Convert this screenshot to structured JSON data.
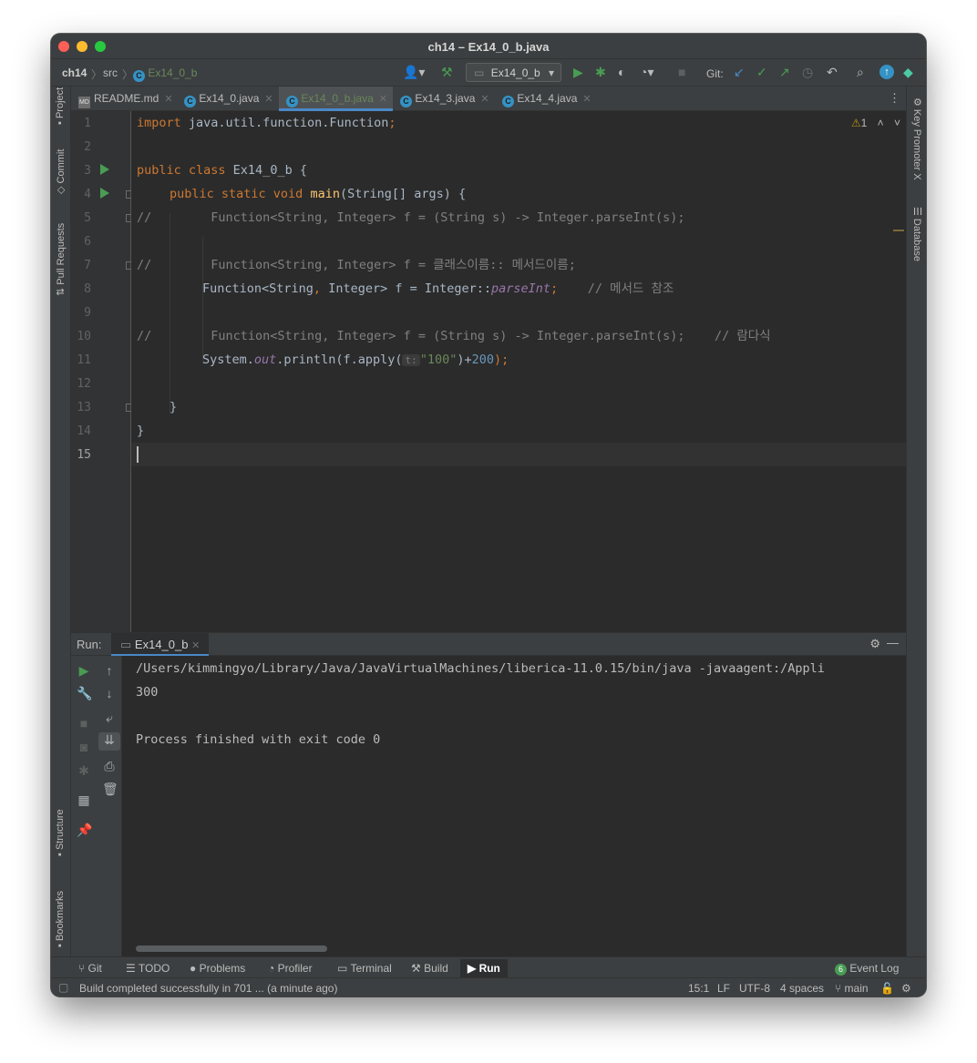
{
  "window": {
    "title": "ch14 – Ex14_0_b.java"
  },
  "navbar": {
    "breadcrumbs": [
      "ch14",
      "src",
      "Ex14_0_b"
    ],
    "run_config": "Ex14_0_b",
    "git_label": "Git:"
  },
  "tabs": [
    {
      "label": "README.md",
      "active": false
    },
    {
      "label": "Ex14_0.java",
      "active": false
    },
    {
      "label": "Ex14_0_b.java",
      "active": true
    },
    {
      "label": "Ex14_3.java",
      "active": false
    },
    {
      "label": "Ex14_4.java",
      "active": false
    }
  ],
  "left_strip": [
    "Project",
    "Commit",
    "Pull Requests",
    "Structure",
    "Bookmarks"
  ],
  "right_strip": [
    "Key Promoter X",
    "Database"
  ],
  "editor": {
    "warning_count": "1",
    "line_numbers": [
      "1",
      "2",
      "3",
      "4",
      "5",
      "6",
      "7",
      "8",
      "9",
      "10",
      "11",
      "12",
      "13",
      "14",
      "15"
    ],
    "lines": {
      "l1_kw": "import",
      "l1_rest": " java.util.function.Function",
      "l1_semi": ";",
      "l3_kw": "public class",
      "l3_rest": " Ex14_0_b {",
      "l4_kw": "public static void",
      "l4_fn": " main",
      "l4_rest": "(String[] args) {",
      "l5": "//        Function<String, Integer> f = (String s) -> Integer.parseInt(s);",
      "l7": "//        Function<String, Integer> f = 클래스이름:: 메서드이름;",
      "l8_a": "Function<String",
      "l8_b": ", ",
      "l8_c": "Integer> f = Integer::",
      "l8_d": "parseInt",
      "l8_e": ";",
      "l8_comment": "// 메서드 참조",
      "l10": "//        Function<String, Integer> f = (String s) -> Integer.parseInt(s);    // 람다식",
      "l11_a": "System.",
      "l11_b": "out",
      "l11_c": ".println(f.apply(",
      "l11_hint": "t:",
      "l11_str": "\"100\"",
      "l11_d": ")+",
      "l11_num": "200",
      "l11_e": ");",
      "l13": "}",
      "l14": "}"
    }
  },
  "run_panel": {
    "label": "Run:",
    "tab": "Ex14_0_b",
    "output": [
      "/Users/kimmingyo/Library/Java/JavaVirtualMachines/liberica-11.0.15/bin/java -javaagent:/Appli",
      "300",
      "",
      "Process finished with exit code 0"
    ]
  },
  "bottom_tabs": [
    "Git",
    "TODO",
    "Problems",
    "Profiler",
    "Terminal",
    "Build",
    "Run"
  ],
  "event_log": {
    "count": "6",
    "label": "Event Log"
  },
  "status": {
    "message": "Build completed successfully in 701 ... (a minute ago)",
    "position": "15:1",
    "line_ending": "LF",
    "encoding": "UTF-8",
    "indent": "4 spaces",
    "branch": "main"
  },
  "colors": {
    "keyword": "#cc7832",
    "function": "#ffc66d",
    "comment": "#808080",
    "string": "#6a8759",
    "number": "#6897bb",
    "run_green": "#499c54",
    "accent_blue": "#4a88c7"
  }
}
